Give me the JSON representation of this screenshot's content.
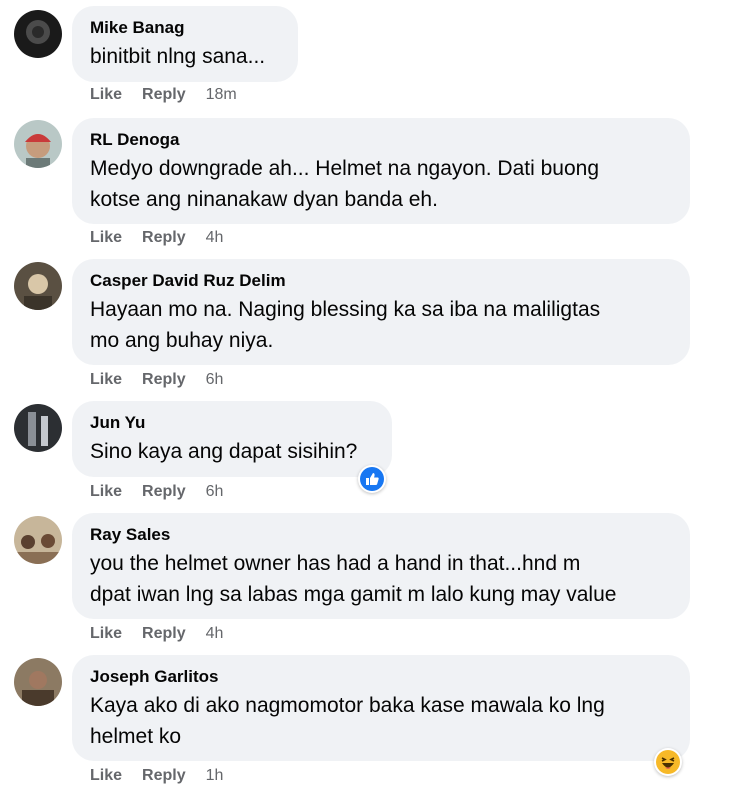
{
  "colors": {
    "bubble_bg": "#f0f2f5",
    "action_text": "#65676b",
    "like_blue": "#1877f2",
    "haha_yellow": "#f7b928"
  },
  "actions": {
    "like": "Like",
    "reply": "Reply"
  },
  "comments": [
    {
      "name": "Mike Banag",
      "text": "binitbit nlng sana...",
      "time": "18m",
      "avatar_icon": "dark-round-avatar",
      "reaction": null
    },
    {
      "name": "RL Denoga",
      "text": "Medyo downgrade ah... Helmet na ngayon. Dati buong\nkotse ang ninanakaw dyan banda eh.",
      "time": "4h",
      "avatar_icon": "person-red-cap-avatar",
      "reaction": null
    },
    {
      "name": "Casper David Ruz Delim",
      "text": "Hayaan mo na. Naging blessing ka sa iba na maliligtas\nmo ang buhay niya.",
      "time": "6h",
      "avatar_icon": "person-photo-avatar",
      "reaction": null
    },
    {
      "name": "Jun Yu",
      "text": "Sino kaya ang dapat sisihin?",
      "time": "6h",
      "avatar_icon": "dark-photo-avatar",
      "reaction": "like-reaction-icon"
    },
    {
      "name": "Ray Sales",
      "text": "you the helmet owner has had a hand in that...hnd m\ndpat iwan lng sa labas mga gamit m lalo kung may value",
      "time": "4h",
      "avatar_icon": "group-photo-avatar",
      "reaction": null
    },
    {
      "name": "Joseph Garlitos",
      "text": "Kaya ako di ako nagmomotor baka kase mawala ko lng\nhelmet ko",
      "time": "1h",
      "avatar_icon": "person-outdoor-avatar",
      "reaction": "haha-reaction-icon"
    }
  ]
}
